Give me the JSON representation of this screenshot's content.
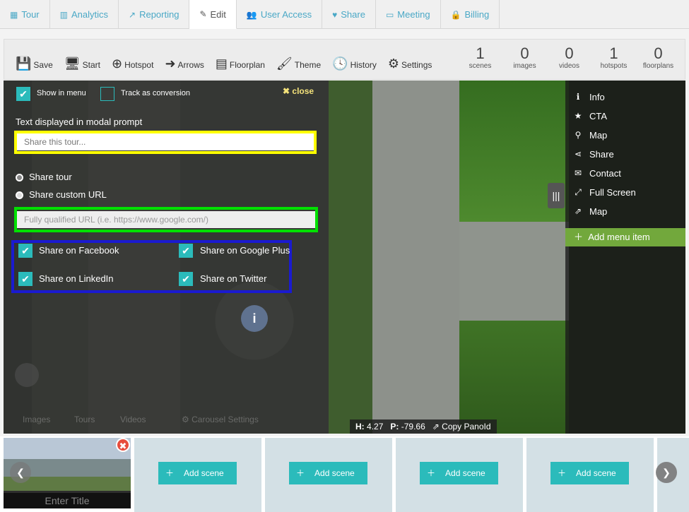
{
  "tabs": [
    {
      "label": "Tour",
      "icon": "map-icon"
    },
    {
      "label": "Analytics",
      "icon": "bar-chart-icon"
    },
    {
      "label": "Reporting",
      "icon": "line-chart-icon"
    },
    {
      "label": "Edit",
      "icon": "pencil-icon",
      "active": true
    },
    {
      "label": "User Access",
      "icon": "users-icon"
    },
    {
      "label": "Share",
      "icon": "heart-icon"
    },
    {
      "label": "Meeting",
      "icon": "monitor-icon"
    },
    {
      "label": "Billing",
      "icon": "lock-icon"
    }
  ],
  "toolbar": {
    "save": "Save",
    "start": "Start",
    "hotspot": "Hotspot",
    "arrows": "Arrows",
    "floorplan": "Floorplan",
    "theme": "Theme",
    "history": "History",
    "settings": "Settings"
  },
  "stats": [
    {
      "value": "1",
      "label": "scenes"
    },
    {
      "value": "0",
      "label": "images"
    },
    {
      "value": "0",
      "label": "videos"
    },
    {
      "value": "1",
      "label": "hotspots"
    },
    {
      "value": "0",
      "label": "floorplans"
    }
  ],
  "share_panel": {
    "show_in_menu": "Show in menu",
    "track_conversion": "Track as conversion",
    "close": "close",
    "modal_text_label": "Text displayed in modal prompt",
    "modal_text_placeholder": "Share this tour...",
    "share_tour": "Share tour",
    "share_custom_url": "Share custom URL",
    "url_placeholder": "Fully qualified URL (i.e. https://www.google.com/)",
    "facebook": "Share on Facebook",
    "google_plus": "Share on Google Plus",
    "linkedin": "Share on LinkedIn",
    "twitter": "Share on Twitter"
  },
  "bottom_faded": {
    "images": "Images",
    "tours": "Tours",
    "videos": "Videos",
    "carousel": "Carousel Settings"
  },
  "menu": [
    {
      "label": "Info",
      "icon": "info-icon"
    },
    {
      "label": "CTA",
      "icon": "star-icon"
    },
    {
      "label": "Map",
      "icon": "map-marker-icon"
    },
    {
      "label": "Share",
      "icon": "share-icon"
    },
    {
      "label": "Contact",
      "icon": "envelope-icon"
    },
    {
      "label": "Full Screen",
      "icon": "fullscreen-icon"
    },
    {
      "label": "Map",
      "icon": "external-link-icon"
    }
  ],
  "add_menu_item": "Add menu item",
  "coords": {
    "h": "4.27",
    "p": "-79.66",
    "copy": "Copy PanoId",
    "h_label": "H:",
    "p_label": "P:"
  },
  "scenes": {
    "title_placeholder": "Enter Title",
    "add_scene": "Add scene"
  }
}
